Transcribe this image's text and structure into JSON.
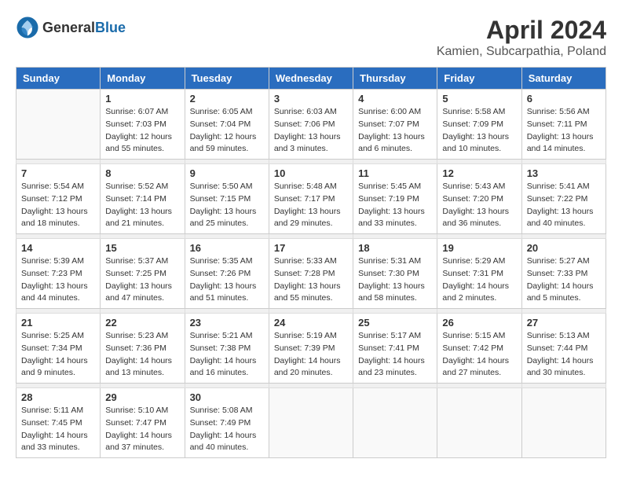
{
  "header": {
    "logo_general": "General",
    "logo_blue": "Blue",
    "month_title": "April 2024",
    "location": "Kamien, Subcarpathia, Poland"
  },
  "weekdays": [
    "Sunday",
    "Monday",
    "Tuesday",
    "Wednesday",
    "Thursday",
    "Friday",
    "Saturday"
  ],
  "weeks": [
    [
      {
        "day": "",
        "sunrise": "",
        "sunset": "",
        "daylight": ""
      },
      {
        "day": "1",
        "sunrise": "Sunrise: 6:07 AM",
        "sunset": "Sunset: 7:03 PM",
        "daylight": "Daylight: 12 hours and 55 minutes."
      },
      {
        "day": "2",
        "sunrise": "Sunrise: 6:05 AM",
        "sunset": "Sunset: 7:04 PM",
        "daylight": "Daylight: 12 hours and 59 minutes."
      },
      {
        "day": "3",
        "sunrise": "Sunrise: 6:03 AM",
        "sunset": "Sunset: 7:06 PM",
        "daylight": "Daylight: 13 hours and 3 minutes."
      },
      {
        "day": "4",
        "sunrise": "Sunrise: 6:00 AM",
        "sunset": "Sunset: 7:07 PM",
        "daylight": "Daylight: 13 hours and 6 minutes."
      },
      {
        "day": "5",
        "sunrise": "Sunrise: 5:58 AM",
        "sunset": "Sunset: 7:09 PM",
        "daylight": "Daylight: 13 hours and 10 minutes."
      },
      {
        "day": "6",
        "sunrise": "Sunrise: 5:56 AM",
        "sunset": "Sunset: 7:11 PM",
        "daylight": "Daylight: 13 hours and 14 minutes."
      }
    ],
    [
      {
        "day": "7",
        "sunrise": "Sunrise: 5:54 AM",
        "sunset": "Sunset: 7:12 PM",
        "daylight": "Daylight: 13 hours and 18 minutes."
      },
      {
        "day": "8",
        "sunrise": "Sunrise: 5:52 AM",
        "sunset": "Sunset: 7:14 PM",
        "daylight": "Daylight: 13 hours and 21 minutes."
      },
      {
        "day": "9",
        "sunrise": "Sunrise: 5:50 AM",
        "sunset": "Sunset: 7:15 PM",
        "daylight": "Daylight: 13 hours and 25 minutes."
      },
      {
        "day": "10",
        "sunrise": "Sunrise: 5:48 AM",
        "sunset": "Sunset: 7:17 PM",
        "daylight": "Daylight: 13 hours and 29 minutes."
      },
      {
        "day": "11",
        "sunrise": "Sunrise: 5:45 AM",
        "sunset": "Sunset: 7:19 PM",
        "daylight": "Daylight: 13 hours and 33 minutes."
      },
      {
        "day": "12",
        "sunrise": "Sunrise: 5:43 AM",
        "sunset": "Sunset: 7:20 PM",
        "daylight": "Daylight: 13 hours and 36 minutes."
      },
      {
        "day": "13",
        "sunrise": "Sunrise: 5:41 AM",
        "sunset": "Sunset: 7:22 PM",
        "daylight": "Daylight: 13 hours and 40 minutes."
      }
    ],
    [
      {
        "day": "14",
        "sunrise": "Sunrise: 5:39 AM",
        "sunset": "Sunset: 7:23 PM",
        "daylight": "Daylight: 13 hours and 44 minutes."
      },
      {
        "day": "15",
        "sunrise": "Sunrise: 5:37 AM",
        "sunset": "Sunset: 7:25 PM",
        "daylight": "Daylight: 13 hours and 47 minutes."
      },
      {
        "day": "16",
        "sunrise": "Sunrise: 5:35 AM",
        "sunset": "Sunset: 7:26 PM",
        "daylight": "Daylight: 13 hours and 51 minutes."
      },
      {
        "day": "17",
        "sunrise": "Sunrise: 5:33 AM",
        "sunset": "Sunset: 7:28 PM",
        "daylight": "Daylight: 13 hours and 55 minutes."
      },
      {
        "day": "18",
        "sunrise": "Sunrise: 5:31 AM",
        "sunset": "Sunset: 7:30 PM",
        "daylight": "Daylight: 13 hours and 58 minutes."
      },
      {
        "day": "19",
        "sunrise": "Sunrise: 5:29 AM",
        "sunset": "Sunset: 7:31 PM",
        "daylight": "Daylight: 14 hours and 2 minutes."
      },
      {
        "day": "20",
        "sunrise": "Sunrise: 5:27 AM",
        "sunset": "Sunset: 7:33 PM",
        "daylight": "Daylight: 14 hours and 5 minutes."
      }
    ],
    [
      {
        "day": "21",
        "sunrise": "Sunrise: 5:25 AM",
        "sunset": "Sunset: 7:34 PM",
        "daylight": "Daylight: 14 hours and 9 minutes."
      },
      {
        "day": "22",
        "sunrise": "Sunrise: 5:23 AM",
        "sunset": "Sunset: 7:36 PM",
        "daylight": "Daylight: 14 hours and 13 minutes."
      },
      {
        "day": "23",
        "sunrise": "Sunrise: 5:21 AM",
        "sunset": "Sunset: 7:38 PM",
        "daylight": "Daylight: 14 hours and 16 minutes."
      },
      {
        "day": "24",
        "sunrise": "Sunrise: 5:19 AM",
        "sunset": "Sunset: 7:39 PM",
        "daylight": "Daylight: 14 hours and 20 minutes."
      },
      {
        "day": "25",
        "sunrise": "Sunrise: 5:17 AM",
        "sunset": "Sunset: 7:41 PM",
        "daylight": "Daylight: 14 hours and 23 minutes."
      },
      {
        "day": "26",
        "sunrise": "Sunrise: 5:15 AM",
        "sunset": "Sunset: 7:42 PM",
        "daylight": "Daylight: 14 hours and 27 minutes."
      },
      {
        "day": "27",
        "sunrise": "Sunrise: 5:13 AM",
        "sunset": "Sunset: 7:44 PM",
        "daylight": "Daylight: 14 hours and 30 minutes."
      }
    ],
    [
      {
        "day": "28",
        "sunrise": "Sunrise: 5:11 AM",
        "sunset": "Sunset: 7:45 PM",
        "daylight": "Daylight: 14 hours and 33 minutes."
      },
      {
        "day": "29",
        "sunrise": "Sunrise: 5:10 AM",
        "sunset": "Sunset: 7:47 PM",
        "daylight": "Daylight: 14 hours and 37 minutes."
      },
      {
        "day": "30",
        "sunrise": "Sunrise: 5:08 AM",
        "sunset": "Sunset: 7:49 PM",
        "daylight": "Daylight: 14 hours and 40 minutes."
      },
      {
        "day": "",
        "sunrise": "",
        "sunset": "",
        "daylight": ""
      },
      {
        "day": "",
        "sunrise": "",
        "sunset": "",
        "daylight": ""
      },
      {
        "day": "",
        "sunrise": "",
        "sunset": "",
        "daylight": ""
      },
      {
        "day": "",
        "sunrise": "",
        "sunset": "",
        "daylight": ""
      }
    ]
  ]
}
